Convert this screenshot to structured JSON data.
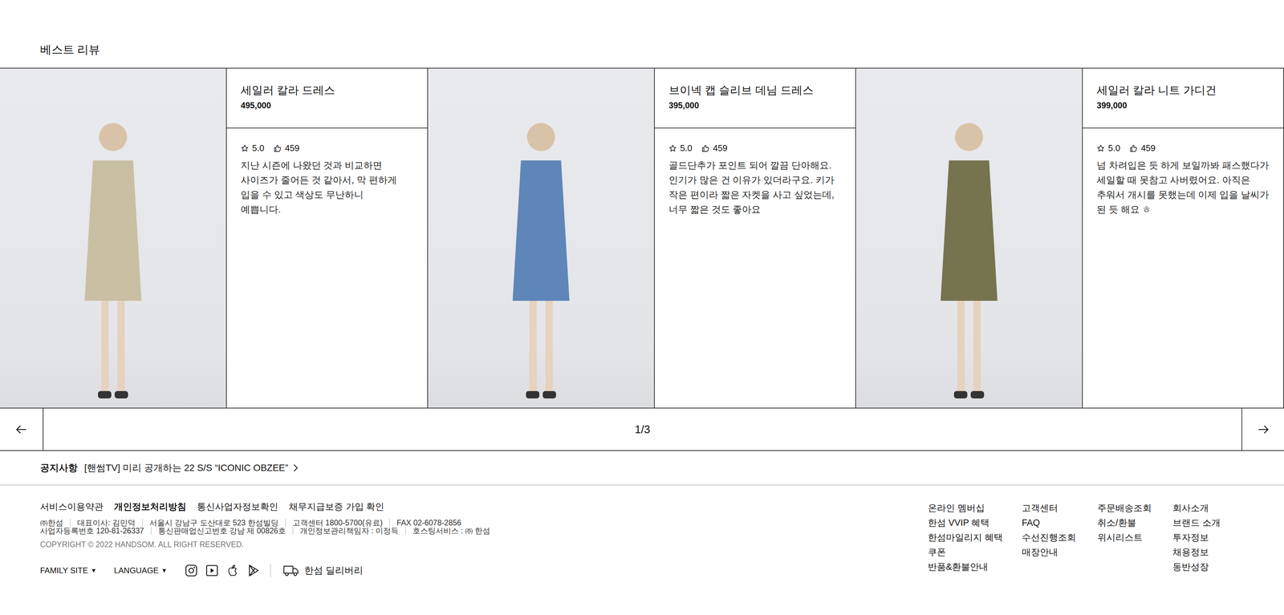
{
  "section_title": "베스트 리뷰",
  "cards": [
    {
      "name": "세일러 칼라 드레스",
      "price": "495,000",
      "rating": "5.0",
      "likes": "459",
      "review": "지난 시즌에 나왔던 것과 비교하면 사이즈가 줄어든 것 같아서, 막 편하게 입을 수 있고 색상도 무난하니\n예쁩니다."
    },
    {
      "name": "브이넥 캡 슬리브 데님 드레스",
      "price": "395,000",
      "rating": "5.0",
      "likes": "459",
      "review": "골드단추가 포인트 되어 깔끔 단아해요. 인기가 많은 건 이유가 있더라구요. 키가 작은 편이라 짧은 자켓을 사고 싶었는데, 너무 짧은 것도 좋아요"
    },
    {
      "name": "세일러 칼라 니트 가디건",
      "price": "399,000",
      "rating": "5.0",
      "likes": "459",
      "review": "넘 차려입은 듯 하게 보일까봐 패스했다가 세일할 때 못참고 사버렸어요. 아직은 추워서 개시를 못했는데 이제 입을 날씨가 된 듯 해요 ㅎ"
    }
  ],
  "pager": "1/3",
  "notice": {
    "label": "공지사항",
    "text": "[핸썸TV] 미리 공개하는 22 S/S “ICONIC OBZEE”"
  },
  "footer": {
    "links": [
      {
        "label": "서비스이용약관",
        "emphasized": false
      },
      {
        "label": "개인정보처리방침",
        "emphasized": true
      },
      {
        "label": "통신사업자정보확인",
        "emphasized": false
      },
      {
        "label": "채무지급보증 가입 확인",
        "emphasized": false
      }
    ],
    "info_lines": [
      [
        "㈜한섬",
        "대표이사: 김민덕",
        "서울시 강남구 도산대로 523 한섬빌딩",
        "고객센터 1800-5700(유료)",
        "FAX  02-6078-2856"
      ],
      [
        "사업자등록번호  120-81-26337",
        "통신판매업신고번호 강남 제 00826호",
        "개인정보관리책임자 : 이정득",
        "호스팅서비스 : ㈜ 한섬"
      ]
    ],
    "copyright": "COPYRIGHT © 2022 HANDSOM. ALL RIGHT RESERVED.",
    "selects": [
      {
        "label": "FAMILY SITE",
        "caret": "▼"
      },
      {
        "label": "LANGUAGE",
        "caret": "▼"
      }
    ],
    "delivery": "한섬 딜리버리",
    "columns": [
      [
        "온라인 멤버십",
        "한섬 VVIP 혜택",
        "한섬마일리지 혜택",
        "쿠폰",
        "반품&환불안내"
      ],
      [
        "고객센터",
        "FAQ",
        "수선진행조회",
        "매장안내"
      ],
      [
        "주문배송조회",
        "취소/환불",
        "위시리스트"
      ],
      [
        "회사소개",
        "브랜드 소개",
        "투자정보",
        "채용정보",
        "동반성장"
      ]
    ]
  }
}
